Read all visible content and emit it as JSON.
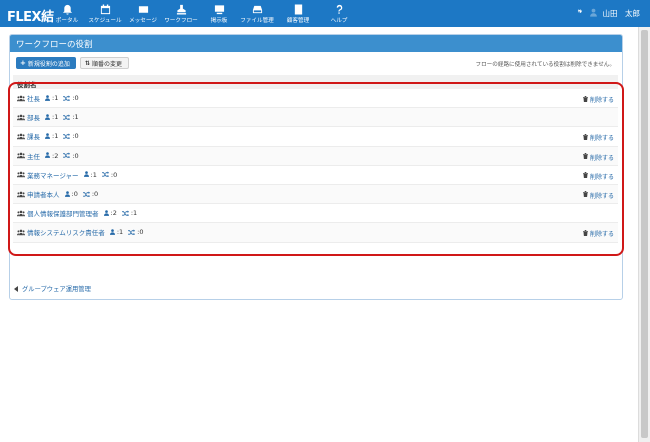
{
  "brand": "FLEX結",
  "nav": [
    {
      "label": "ポータル",
      "icon": "bell-icon"
    },
    {
      "label": "スケジュール",
      "icon": "calendar-icon"
    },
    {
      "label": "メッセージ",
      "icon": "envelope-icon"
    },
    {
      "label": "ワークフロー",
      "icon": "stamp-icon"
    },
    {
      "label": "掲示板",
      "icon": "board-icon"
    },
    {
      "label": "ファイル管理",
      "icon": "drive-icon"
    },
    {
      "label": "顧客管理",
      "icon": "contact-book-icon"
    },
    {
      "label": "ヘルプ",
      "icon": "question-icon"
    }
  ],
  "user": {
    "name": "山田　太郎"
  },
  "panel": {
    "title": "ワークフローの役割",
    "add_button": "新規役割の追加",
    "order_button": "順番の変更",
    "note": "フローの経路に使用されている役割は削除できません。",
    "column_header": "役割名",
    "delete_label": "削除する",
    "back_link": "グループウェア運用管理"
  },
  "roles": [
    {
      "name": "社長",
      "users": ":1",
      "flows": ":0",
      "deletable": true
    },
    {
      "name": "部長",
      "users": ":1",
      "flows": ":1",
      "deletable": false
    },
    {
      "name": "課長",
      "users": ":1",
      "flows": ":0",
      "deletable": true
    },
    {
      "name": "主任",
      "users": ":2",
      "flows": ":0",
      "deletable": true
    },
    {
      "name": "業務マネージャー",
      "users": ":1",
      "flows": ":0",
      "deletable": true
    },
    {
      "name": "申請者本人",
      "users": ":0",
      "flows": ":0",
      "deletable": true
    },
    {
      "name": "個人情報保護部門管理者",
      "users": ":2",
      "flows": ":1",
      "deletable": false
    },
    {
      "name": "情報システムリスク責任者",
      "users": ":1",
      "flows": ":0",
      "deletable": true
    }
  ],
  "colors": {
    "nav_bg": "#1d78c5",
    "panel_head": "#3c8fce",
    "highlight": "#d01818",
    "link": "#2569a8"
  }
}
